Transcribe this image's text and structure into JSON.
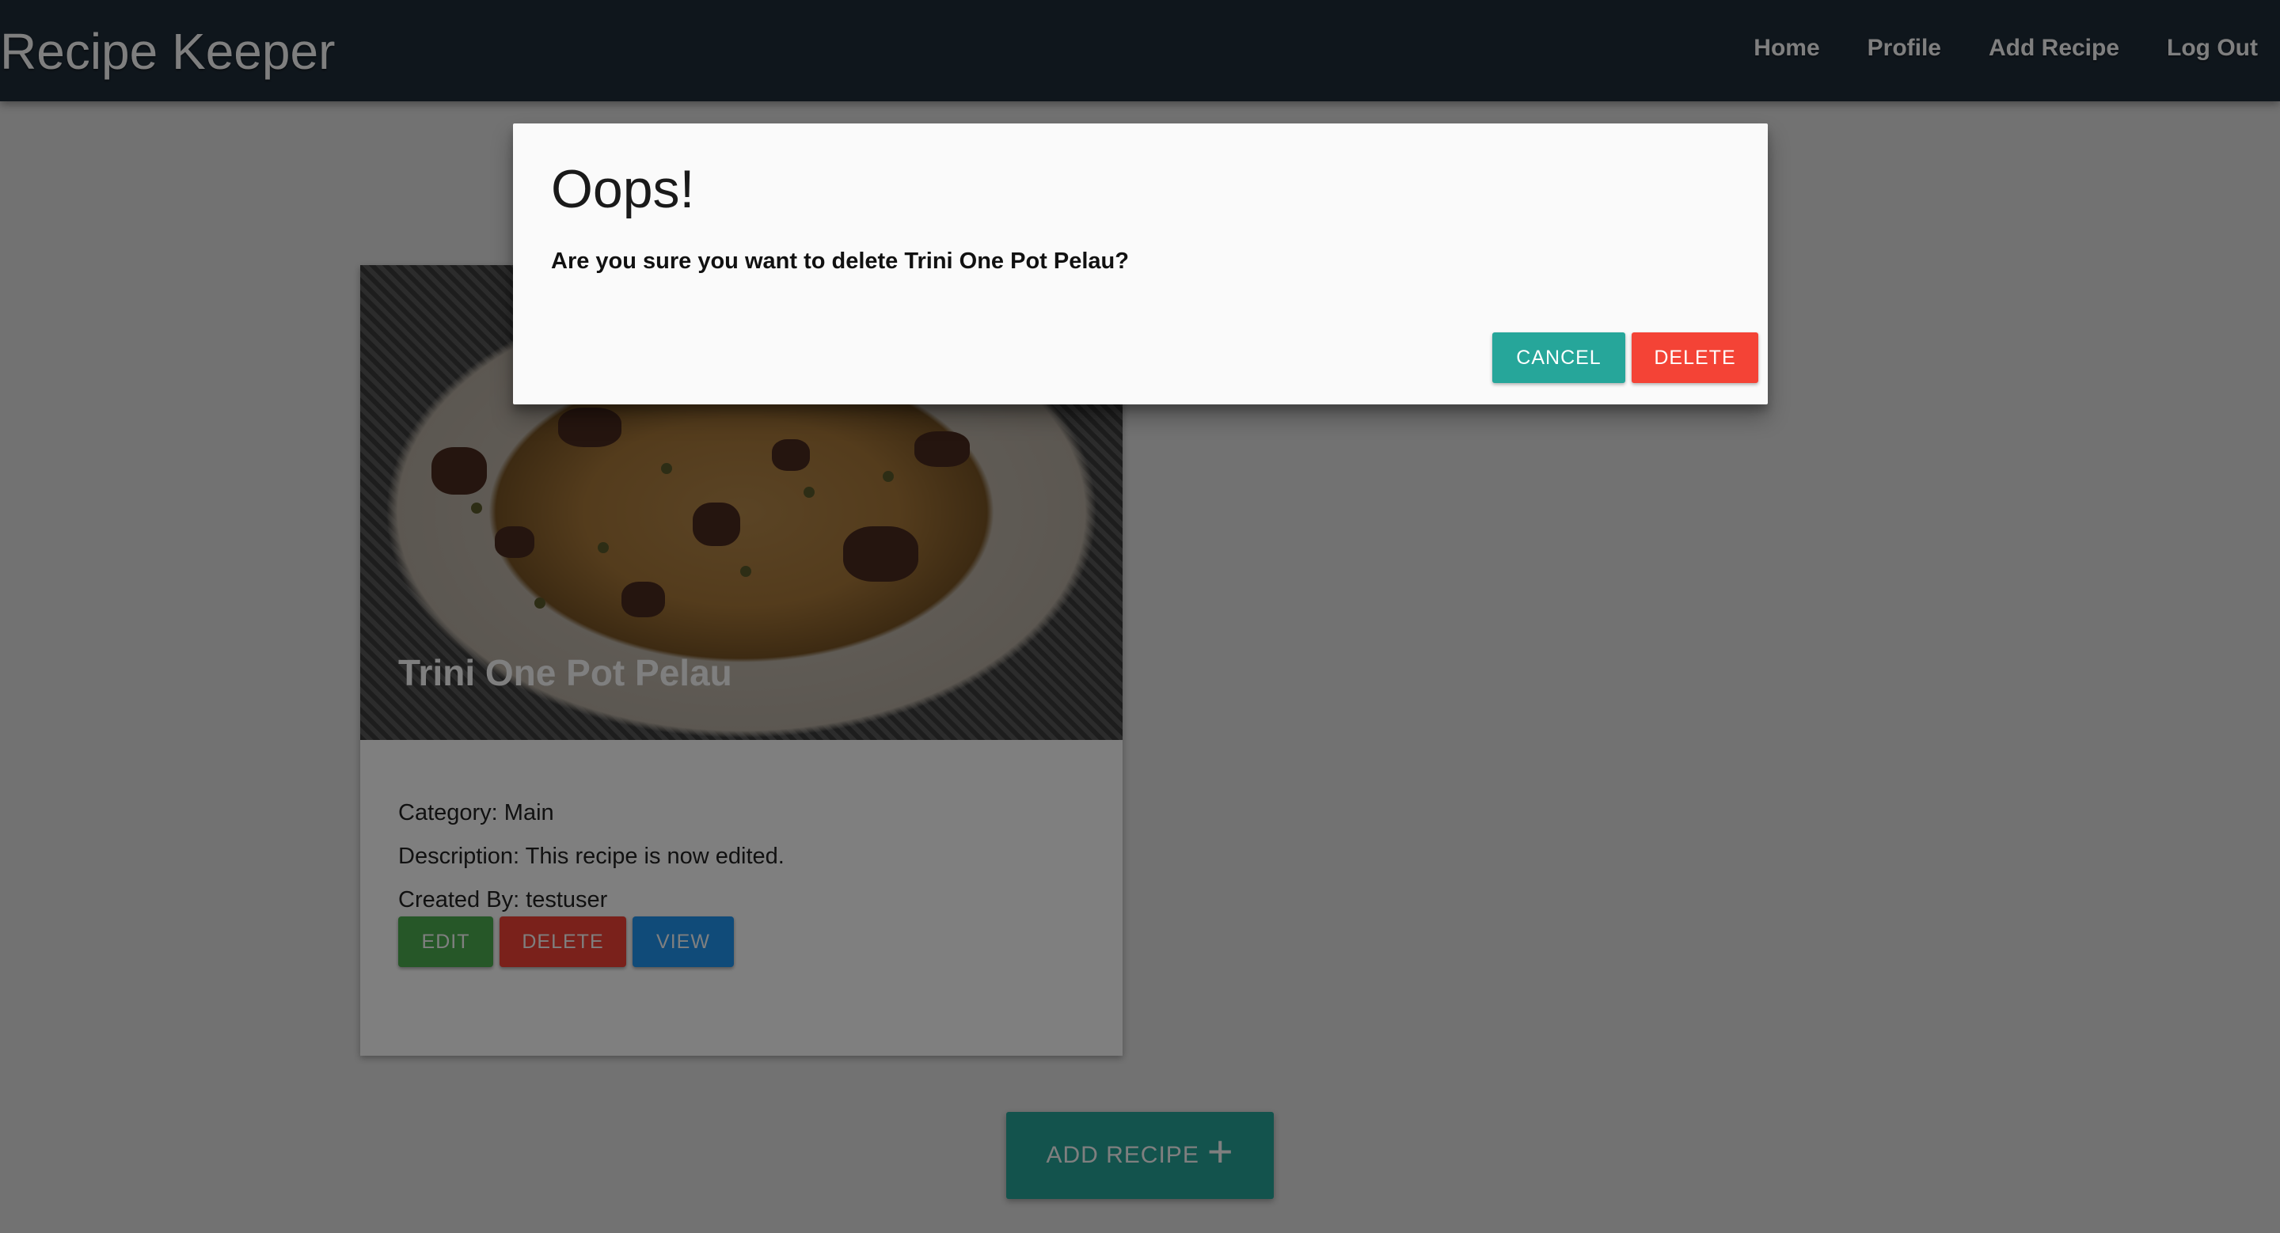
{
  "navbar": {
    "brand": "Recipe Keeper",
    "links": [
      "Home",
      "Profile",
      "Add Recipe",
      "Log Out"
    ]
  },
  "recipe_card": {
    "title": "Trini One Pot Pelau",
    "category": "Category: Main",
    "description": "Description: This recipe is now edited.",
    "created_by": "Created By: testuser",
    "buttons": {
      "edit": "EDIT",
      "delete": "DELETE",
      "view": "VIEW"
    },
    "colors": {
      "edit": "#4caf50",
      "delete": "#f44336",
      "view": "#2196f3"
    }
  },
  "add_recipe_button": {
    "label": "ADD RECIPE",
    "icon": "+"
  },
  "modal": {
    "title": "Oops!",
    "message": "Are you sure you want to delete Trini One Pot Pelau?",
    "cancel_label": "CANCEL",
    "delete_label": "DELETE",
    "colors": {
      "cancel": "#26a69a",
      "delete": "#f44336"
    }
  }
}
